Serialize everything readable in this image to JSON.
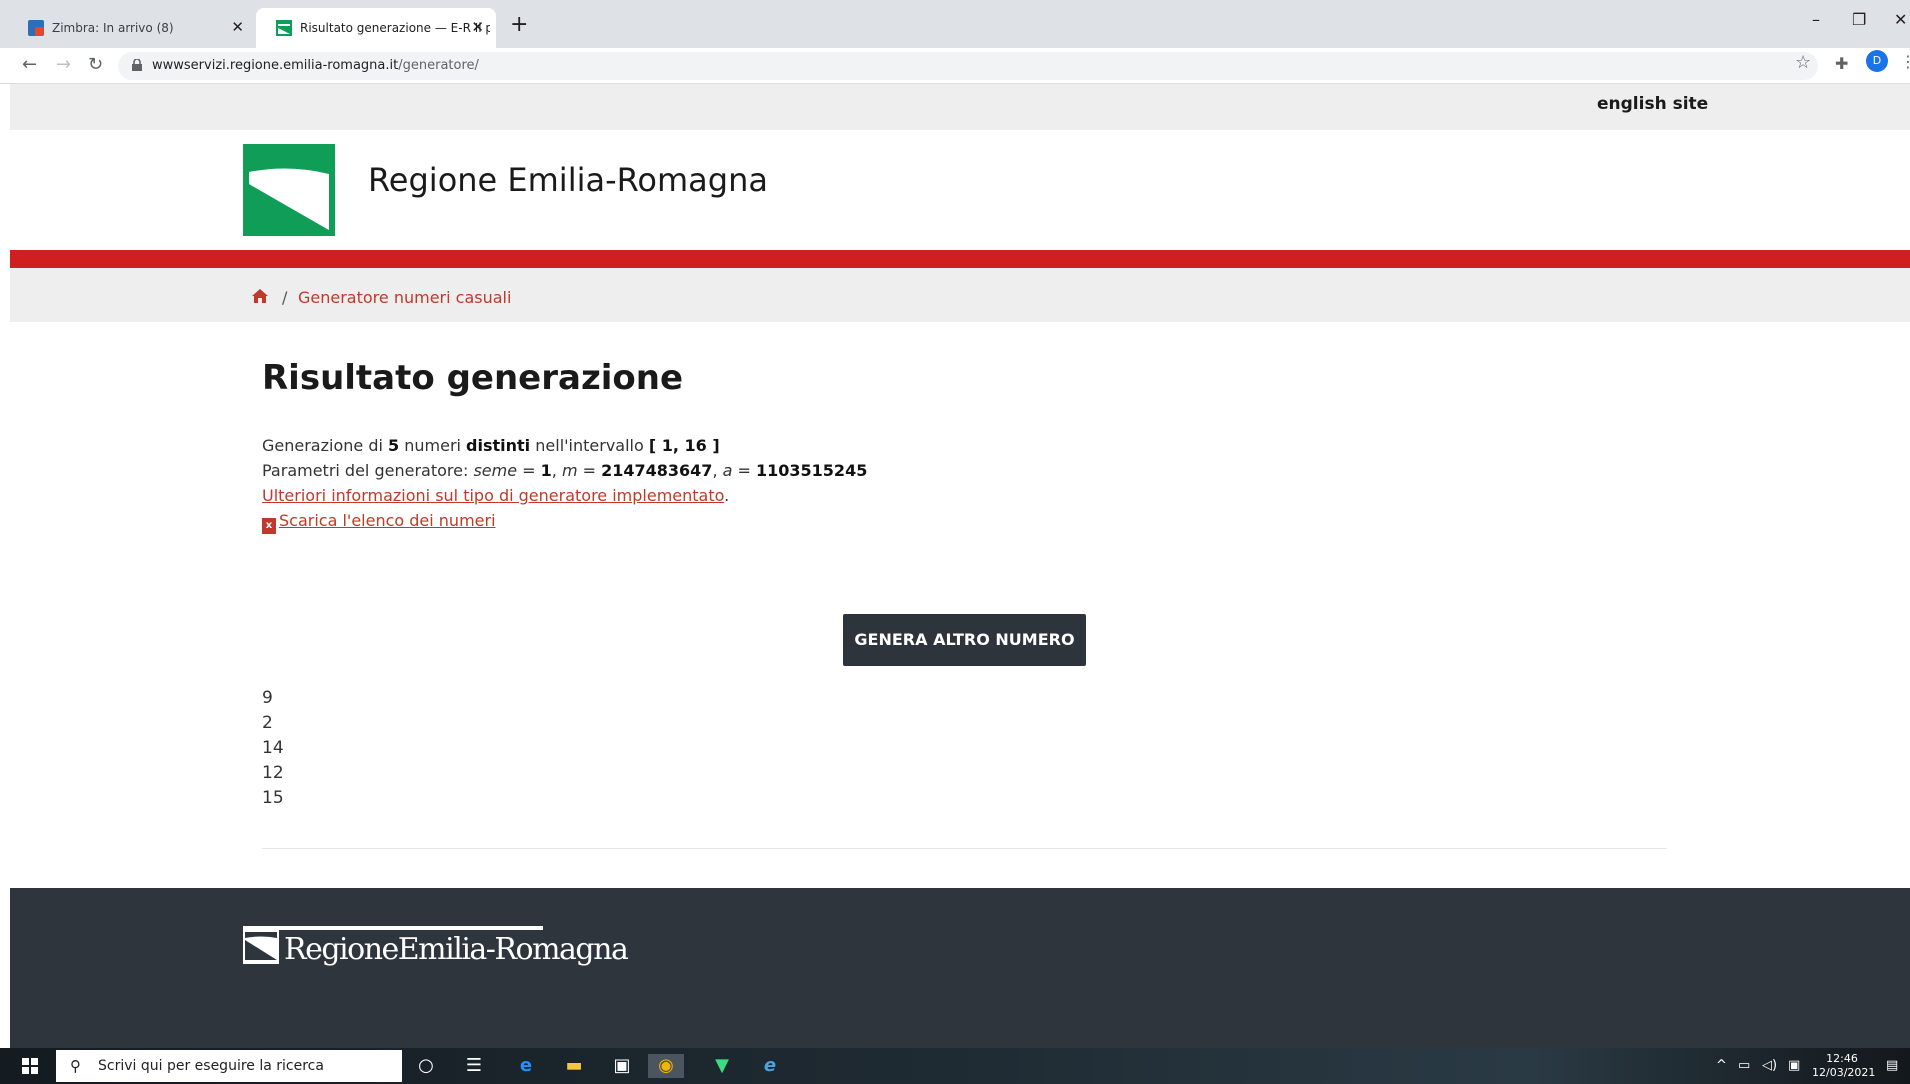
{
  "browser": {
    "tabs": [
      {
        "title": "Zimbra: In arrivo (8)"
      },
      {
        "title": "Risultato generazione — E-R Il p"
      }
    ],
    "url_host": "wwwservizi.regione.emilia-romagna.it",
    "url_path": "/generatore/",
    "profile_initial": "D"
  },
  "site": {
    "english_link": "english site",
    "title": "Regione Emilia-Romagna",
    "breadcrumb": "Generatore numeri casuali",
    "footer_logo": "RegioneEmilia-Romagna"
  },
  "result": {
    "heading": "Risultato generazione",
    "line1": {
      "pre": "Generazione di ",
      "count": "5",
      "mid": " numeri ",
      "kind": "distinti",
      "post": " nell'intervallo ",
      "range": "[ 1, 16 ]"
    },
    "line2": {
      "pre": "Parametri del generatore: ",
      "seed_label": "seme",
      "eq1": " = ",
      "seed": "1",
      "sep1": ", ",
      "m_label": "m",
      "eq2": " = ",
      "m": "2147483647",
      "sep2": ", ",
      "a_label": "a",
      "eq3": " = ",
      "a": "1103515245"
    },
    "more_info_link": "Ulteriori informazioni sul tipo di generatore implementato",
    "more_info_tail": ".",
    "download_link": "Scarica l'elenco dei numeri",
    "button_label": "GENERA ALTRO NUMERO",
    "numbers": [
      "9",
      "2",
      "14",
      "12",
      "15"
    ]
  },
  "taskbar": {
    "search_placeholder": "Scrivi qui per eseguire la ricerca",
    "time": "12:46",
    "date": "12/03/2021"
  },
  "colors": {
    "brand_red": "#cf1f1f",
    "brand_green": "#0f9d58",
    "button_dark": "#2e343b",
    "footer_bg": "#2e353d"
  }
}
